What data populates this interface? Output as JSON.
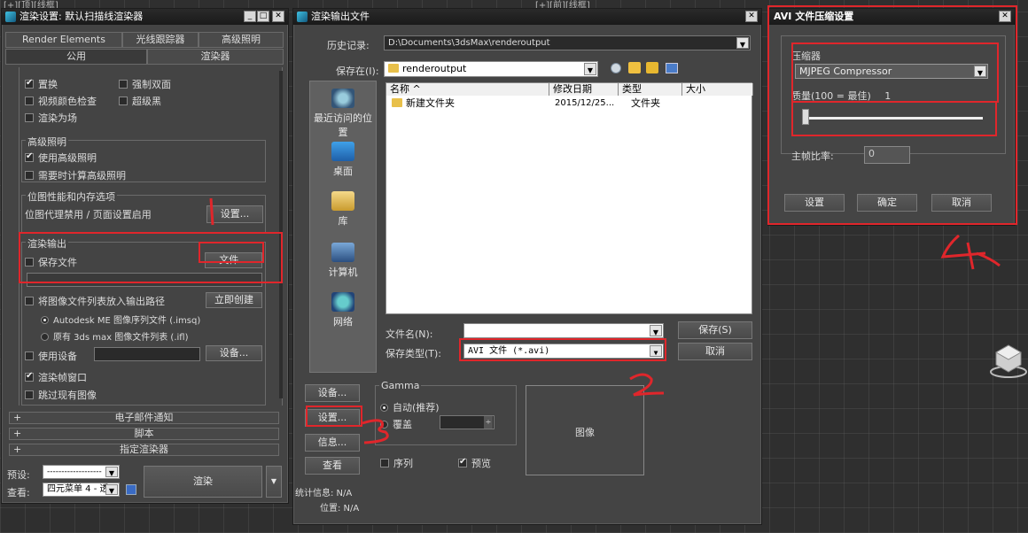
{
  "viewport": {
    "top_left_labels": "[+][顶][线框]",
    "top_right_labels": "[+][前][线框]"
  },
  "render_setup": {
    "title": "渲染设置: 默认扫描线渲染器",
    "tabs_row1": [
      "Render Elements",
      "光线跟踪器",
      "高级照明"
    ],
    "tabs_row2": [
      "公用",
      "渲染器"
    ],
    "options": {
      "displacement": "置换",
      "force_two_sided": "强制双面",
      "video_color_check": "视频颜色检查",
      "super_black": "超级黑",
      "render_to_fields": "渲染为场"
    },
    "adv_lighting": {
      "title": "高级照明",
      "use_adv": "使用高级照明",
      "compute_when_required": "需要时计算高级照明"
    },
    "bitmap": {
      "title": "位图性能和内存选项",
      "info": "位图代理禁用 / 页面设置启用",
      "setup_btn": "设置..."
    },
    "render_output": {
      "title": "渲染输出",
      "save_file": "保存文件",
      "files_btn": "文件...",
      "put_image_list": "将图像文件列表放入输出路径",
      "create_now_btn": "立即创建",
      "autodesk_me": "Autodesk ME 图像序列文件 (.imsq)",
      "legacy": "原有 3ds max 图像文件列表 (.ifl)",
      "use_device": "使用设备",
      "devices_btn": "设备...",
      "render_frame_window": "渲染帧窗口",
      "skip_existing": "跳过现有图像"
    },
    "rollouts": [
      "电子邮件通知",
      "脚本",
      "指定渲染器"
    ],
    "preset_label": "预设:",
    "preset_value": "-------------------",
    "view_label": "查看:",
    "view_value": "四元菜单 4 - 透",
    "render_btn": "渲染"
  },
  "save_dialog": {
    "title": "渲染输出文件",
    "history_label": "历史记录:",
    "history_value": "D:\\Documents\\3dsMax\\renderoutput",
    "save_in_label": "保存在(I):",
    "save_in_value": "renderoutput",
    "places": [
      "最近访问的位置",
      "桌面",
      "库",
      "计算机",
      "网络"
    ],
    "columns": [
      "名称",
      "修改日期",
      "类型",
      "大小"
    ],
    "files": [
      {
        "name": "新建文件夹",
        "date": "2015/12/25...",
        "type": "文件夹"
      }
    ],
    "filename_label": "文件名(N):",
    "filename_value": "",
    "filetype_label": "保存类型(T):",
    "filetype_value": "AVI 文件 (*.avi)",
    "save_btn": "保存(S)",
    "cancel_btn": "取消",
    "devices_btn": "设备...",
    "setup_btn": "设置...",
    "info_btn": "信息...",
    "view_btn": "查看",
    "gamma": {
      "title": "Gamma",
      "auto": "自动(推荐)",
      "override": "覆盖"
    },
    "sequence": "序列",
    "preview": "预览",
    "image_label": "图像",
    "stats_label": "统计信息: N/A",
    "location_label": "位置: N/A"
  },
  "avi_dialog": {
    "title": "AVI 文件压缩设置",
    "compressor_label": "压缩器",
    "compressor_value": "MJPEG Compressor",
    "quality_label": "质量(100 = 最佳)",
    "quality_value": "1",
    "quality_fraction": 0.01,
    "keyframe_label": "主帧比率:",
    "keyframe_value": "0",
    "setup_btn": "设置",
    "ok_btn": "确定",
    "cancel_btn": "取消"
  },
  "annotations": [
    "1",
    "2",
    "3",
    "4"
  ],
  "colors": {
    "annotation_red": "#e0262b",
    "window_bg": "#444444",
    "titlebar": "#2a4a72"
  }
}
